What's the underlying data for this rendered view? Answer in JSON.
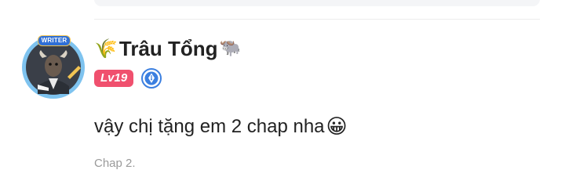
{
  "user": {
    "lead_icon": "🌾",
    "name": "Trâu Tổng",
    "trail_icon": "🐃",
    "avatar_badge": "WRITER",
    "level": "Lv19",
    "role_icon": "pen-nib-icon"
  },
  "comment": {
    "text": "vậy chị tặng em 2 chap nha",
    "emoji": "😀"
  },
  "meta": {
    "chapter": "Chap 2."
  },
  "colors": {
    "level_badge": "#f0506e",
    "role_badge": "#3b7fe0",
    "name_text": "#222222",
    "muted_text": "#9a9a9a"
  }
}
